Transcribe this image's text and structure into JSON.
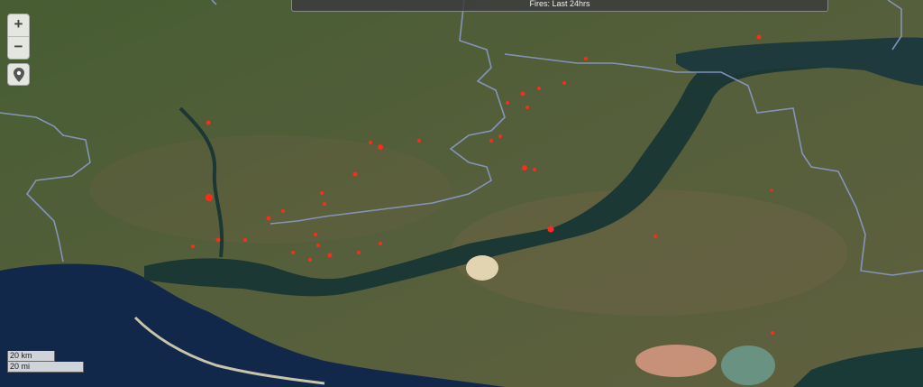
{
  "header": {
    "title": "Fires: Last 24hrs"
  },
  "controls": {
    "zoom_in_label": "+",
    "zoom_out_label": "−",
    "locate_icon": "map-pin-icon"
  },
  "scale": {
    "km_label": "20 km",
    "mi_label": "20 mi"
  },
  "colors": {
    "fire": "#ff2a1a",
    "water": "#1a3a3a",
    "sea": "#102540",
    "border": "#8a9ac8"
  }
}
